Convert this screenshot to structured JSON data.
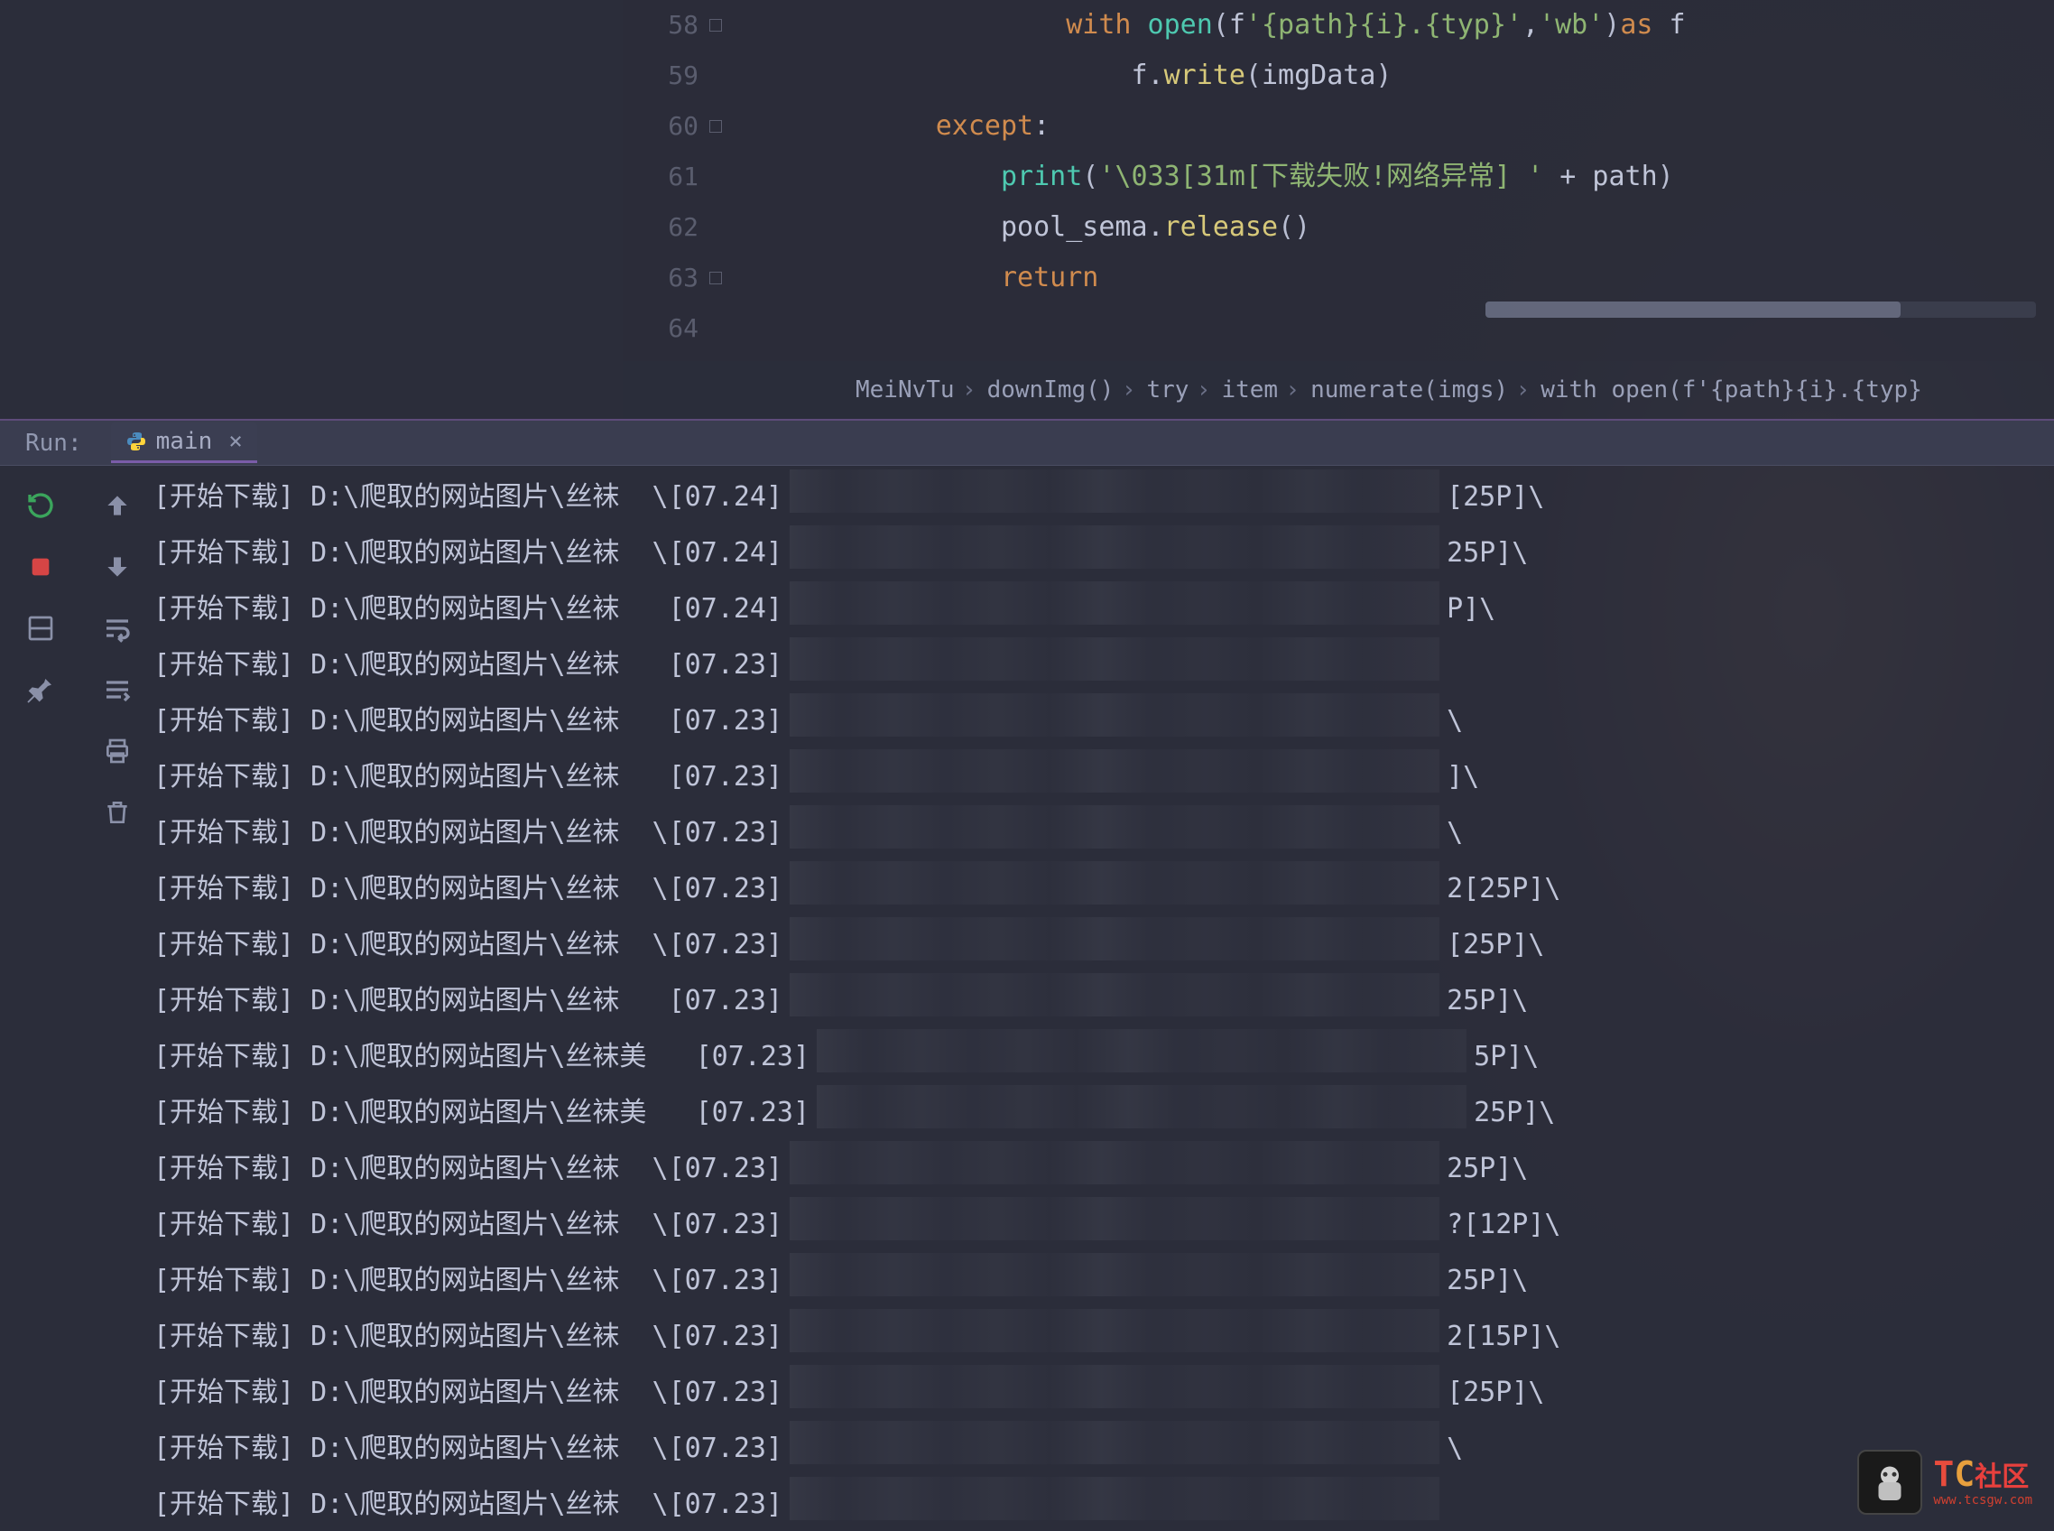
{
  "editor": {
    "lines": [
      {
        "num": "58",
        "indent": "                    ",
        "tokens": [
          [
            "kw-orange",
            "with"
          ],
          [
            "kw-white",
            " "
          ],
          [
            "kw-teal",
            "open"
          ],
          [
            "kw-paren",
            "("
          ],
          [
            "kw-white",
            "f"
          ],
          [
            "kw-string",
            "'{path}{i}.{typ}'"
          ],
          [
            "kw-white",
            ","
          ],
          [
            "kw-string",
            "'wb'"
          ],
          [
            "kw-paren",
            ")"
          ],
          [
            "kw-orange",
            "as"
          ],
          [
            "kw-white",
            " f"
          ]
        ]
      },
      {
        "num": "59",
        "indent": "                        ",
        "tokens": [
          [
            "kw-white",
            "f."
          ],
          [
            "kw-yellow",
            "write"
          ],
          [
            "kw-paren",
            "("
          ],
          [
            "kw-white",
            "imgData"
          ],
          [
            "kw-paren",
            ")"
          ]
        ]
      },
      {
        "num": "60",
        "indent": "            ",
        "tokens": [
          [
            "kw-orange",
            "except"
          ],
          [
            "kw-white",
            ":"
          ]
        ]
      },
      {
        "num": "61",
        "indent": "                ",
        "tokens": [
          [
            "kw-teal",
            "print"
          ],
          [
            "kw-paren",
            "("
          ],
          [
            "kw-string",
            "'\\033[31m[下载失败!网络异常] '"
          ],
          [
            "kw-white",
            " + path"
          ],
          [
            "kw-paren",
            ")"
          ]
        ]
      },
      {
        "num": "62",
        "indent": "                ",
        "tokens": [
          [
            "kw-white",
            "pool_sema."
          ],
          [
            "kw-yellow",
            "release"
          ],
          [
            "kw-paren",
            "()"
          ]
        ]
      },
      {
        "num": "63",
        "indent": "                ",
        "tokens": [
          [
            "kw-orange",
            "return"
          ]
        ]
      },
      {
        "num": "64",
        "indent": "",
        "tokens": []
      }
    ]
  },
  "breadcrumbs": [
    "MeiNvTu",
    "downImg()",
    "try",
    "item",
    "numerate(imgs)",
    "with open(f'{path}{i}.{typ}"
  ],
  "run": {
    "label": "Run:",
    "tab_name": "main",
    "tab_close": "×"
  },
  "console": [
    {
      "prefix": "[开始下载] D:\\爬取的网站图片\\丝袜",
      "mid": "\\[07.24]",
      "suffix": "[25P]\\"
    },
    {
      "prefix": "[开始下载] D:\\爬取的网站图片\\丝袜",
      "mid": "\\[07.24]",
      "suffix": "25P]\\"
    },
    {
      "prefix": "[开始下载] D:\\爬取的网站图片\\丝袜",
      "mid": " [07.24]",
      "suffix": "P]\\"
    },
    {
      "prefix": "[开始下载] D:\\爬取的网站图片\\丝袜",
      "mid": " [07.23]",
      "suffix": ""
    },
    {
      "prefix": "[开始下载] D:\\爬取的网站图片\\丝袜",
      "mid": " [07.23]",
      "suffix": "\\"
    },
    {
      "prefix": "[开始下载] D:\\爬取的网站图片\\丝袜",
      "mid": " [07.23]",
      "suffix": "]\\"
    },
    {
      "prefix": "[开始下载] D:\\爬取的网站图片\\丝袜",
      "mid": "\\[07.23]",
      "suffix": "\\"
    },
    {
      "prefix": "[开始下载] D:\\爬取的网站图片\\丝袜",
      "mid": "\\[07.23]",
      "suffix": "2[25P]\\"
    },
    {
      "prefix": "[开始下载] D:\\爬取的网站图片\\丝袜",
      "mid": "\\[07.23]",
      "suffix": "[25P]\\"
    },
    {
      "prefix": "[开始下载] D:\\爬取的网站图片\\丝袜",
      "mid": " [07.23]",
      "suffix": "25P]\\"
    },
    {
      "prefix": "[开始下载] D:\\爬取的网站图片\\丝袜美",
      "mid": " [07.23]",
      "suffix": "5P]\\"
    },
    {
      "prefix": "[开始下载] D:\\爬取的网站图片\\丝袜美",
      "mid": " [07.23]",
      "suffix": "25P]\\"
    },
    {
      "prefix": "[开始下载] D:\\爬取的网站图片\\丝袜",
      "mid": "\\[07.23]",
      "suffix": "25P]\\"
    },
    {
      "prefix": "[开始下载] D:\\爬取的网站图片\\丝袜",
      "mid": "\\[07.23]",
      "suffix": "?[12P]\\"
    },
    {
      "prefix": "[开始下载] D:\\爬取的网站图片\\丝袜",
      "mid": "\\[07.23]",
      "suffix": "25P]\\"
    },
    {
      "prefix": "[开始下载] D:\\爬取的网站图片\\丝袜",
      "mid": "\\[07.23]",
      "suffix": "2[15P]\\"
    },
    {
      "prefix": "[开始下载] D:\\爬取的网站图片\\丝袜",
      "mid": "\\[07.23]",
      "suffix": "[25P]\\"
    },
    {
      "prefix": "[开始下载] D:\\爬取的网站图片\\丝袜",
      "mid": "\\[07.23]",
      "suffix": "\\"
    },
    {
      "prefix": "[开始下载] D:\\爬取的网站图片\\丝袜",
      "mid": "\\[07.23]",
      "suffix": ""
    }
  ],
  "watermark": {
    "t": "T",
    "c": "C",
    "zh": "社区",
    "sub": "www.tcsgw.com"
  }
}
